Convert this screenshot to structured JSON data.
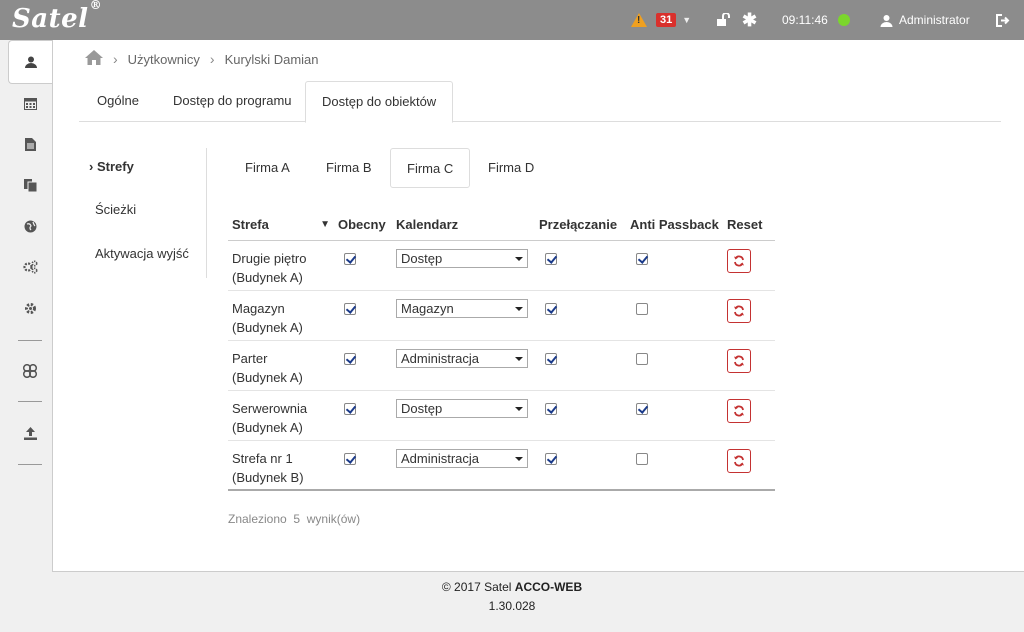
{
  "topbar": {
    "logo": "Satel",
    "logo_mark": "®",
    "alerts_count": "31",
    "time": "09:11:46",
    "user": "Administrator",
    "colors": {
      "bar": "#8c8c8c",
      "badge": "#d9302c",
      "status": "#7bd62c",
      "warning": "#f0a020"
    }
  },
  "sidebar": {
    "items": [
      "user-icon",
      "calendar-icon",
      "document-icon",
      "documents-icon",
      "globe-icon",
      "gears-icon",
      "gear-icon",
      "network-icon",
      "upload-icon"
    ]
  },
  "breadcrumb": {
    "items": [
      "Użytkownicy",
      "Kurylski Damian"
    ]
  },
  "tabs": [
    {
      "label": "Ogólne"
    },
    {
      "label": "Dostęp do programu"
    },
    {
      "label": "Dostęp do obiektów"
    }
  ],
  "subnav": {
    "items": [
      {
        "label": "Strefy",
        "prefix": "›"
      },
      {
        "label": "Ścieżki"
      },
      {
        "label": "Aktywacja wyjść"
      }
    ]
  },
  "companies": [
    {
      "label": "Firma A"
    },
    {
      "label": "Firma B"
    },
    {
      "label": "Firma C"
    },
    {
      "label": "Firma D"
    }
  ],
  "table": {
    "columns": [
      "Strefa",
      "Obecny",
      "Kalendarz",
      "Przełączanie",
      "Anti Passback",
      "Reset"
    ],
    "rows": [
      {
        "zone": "Drugie piętro",
        "building": "(Budynek A)",
        "present": true,
        "calendar": "Dostęp",
        "switching": true,
        "antipassback": true
      },
      {
        "zone": "Magazyn",
        "building": "(Budynek A)",
        "present": true,
        "calendar": "Magazyn",
        "switching": true,
        "antipassback": false
      },
      {
        "zone": "Parter",
        "building": "(Budynek A)",
        "present": true,
        "calendar": "Administracja",
        "switching": true,
        "antipassback": false
      },
      {
        "zone": "Serwerownia",
        "building": "(Budynek A)",
        "present": true,
        "calendar": "Dostęp",
        "switching": true,
        "antipassback": true
      },
      {
        "zone": "Strefa nr 1",
        "building": "(Budynek B)",
        "present": true,
        "calendar": "Administracja",
        "switching": true,
        "antipassback": false
      }
    ]
  },
  "found": {
    "prefix": "Znaleziono",
    "count": "5",
    "suffix": "wynik(ów)"
  },
  "footer": {
    "copyright": "© 2017 Satel",
    "product": "ACCO-WEB",
    "version": "1.30.028"
  }
}
